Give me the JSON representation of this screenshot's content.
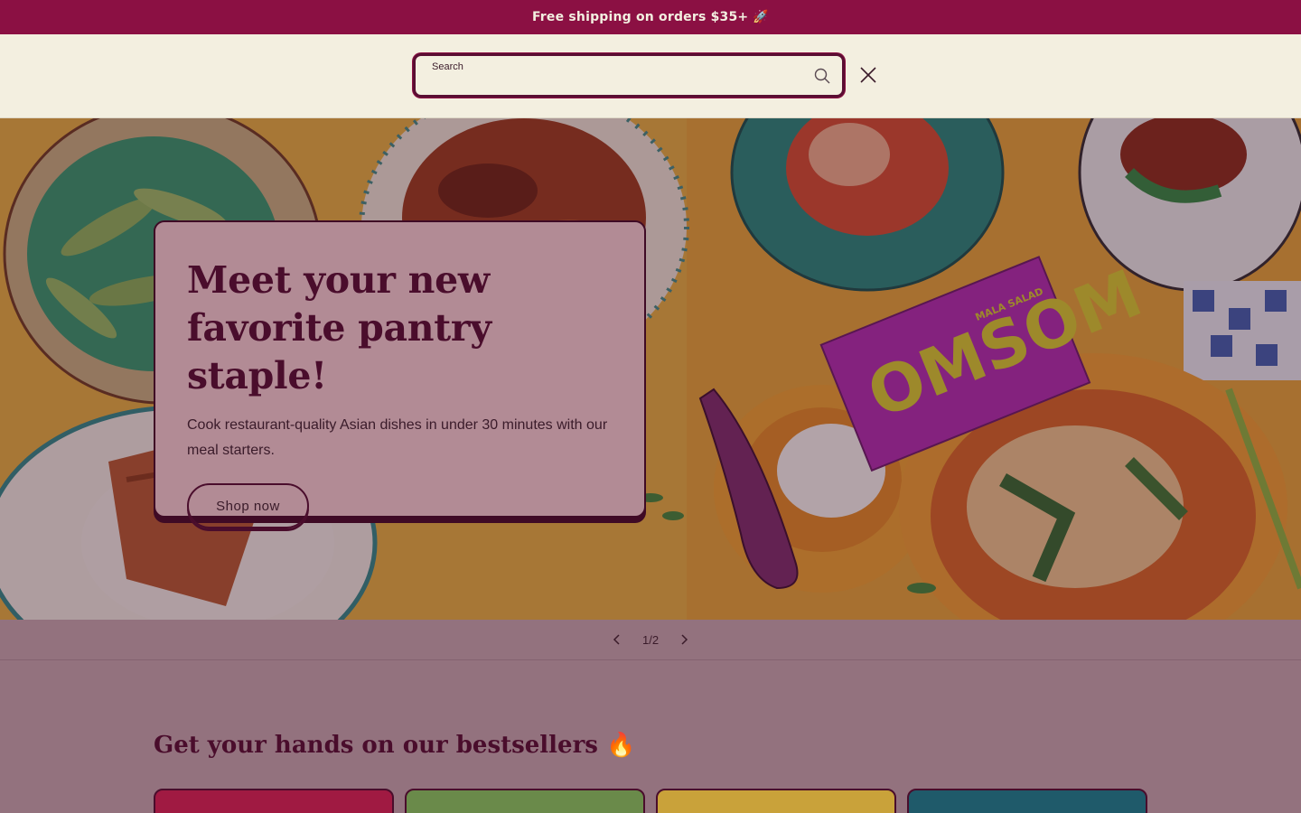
{
  "announcement": {
    "text": "Free shipping on orders $35+ 🚀"
  },
  "search": {
    "label": "Search",
    "value": "",
    "placeholder": "Search"
  },
  "hero": {
    "title": "Meet your new favorite pantry staple!",
    "subtitle": "Cook restaurant-quality Asian dishes in under 30 minutes with our meal starters.",
    "cta": "Shop now",
    "product_text": "OMSOM",
    "product_flavor": "MALA SALAD"
  },
  "slider": {
    "current": "1",
    "separator": "/",
    "total": "2"
  },
  "bestsellers": {
    "title": "Get your hands on our bestsellers 🔥"
  },
  "icons": {
    "search": "search-icon",
    "close": "close-icon",
    "prev": "chevron-left-icon",
    "next": "chevron-right-icon"
  },
  "colors": {
    "brand": "#8b1043",
    "cream": "#f3efe0",
    "ink": "#4a0d2c"
  }
}
